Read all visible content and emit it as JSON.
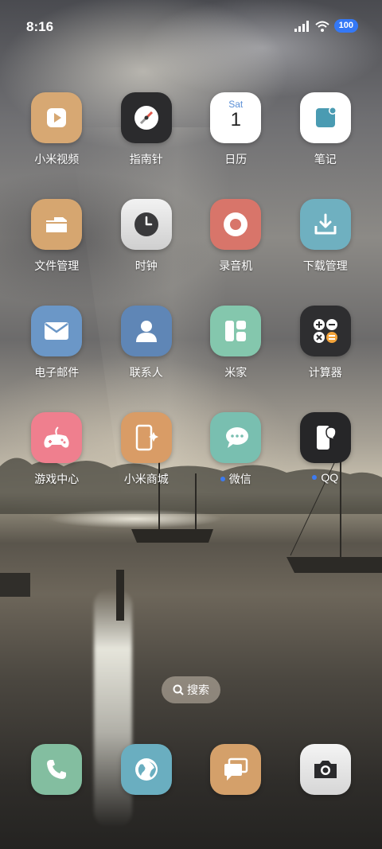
{
  "status_bar": {
    "time": "8:16",
    "battery": "100",
    "icons": [
      "signal-icon",
      "wifi-icon",
      "battery-icon"
    ]
  },
  "apps": [
    {
      "label": "小米视频",
      "icon": "video-play-icon",
      "color": "#d7a873"
    },
    {
      "label": "指南针",
      "icon": "compass-icon",
      "color": "#2b2b2d"
    },
    {
      "label": "日历",
      "icon": "calendar-icon",
      "color": "#ffffff",
      "calendar_day": "Sat",
      "calendar_date": "1"
    },
    {
      "label": "笔记",
      "icon": "notes-icon",
      "color": "#ffffff"
    },
    {
      "label": "文件管理",
      "icon": "folder-icon",
      "color": "#d6a670"
    },
    {
      "label": "时钟",
      "icon": "clock-icon",
      "color": "#e6e6e6"
    },
    {
      "label": "录音机",
      "icon": "record-icon",
      "color": "#d8756a"
    },
    {
      "label": "下载管理",
      "icon": "download-icon",
      "color": "#6fb0c0"
    },
    {
      "label": "电子邮件",
      "icon": "mail-icon",
      "color": "#6b97c7"
    },
    {
      "label": "联系人",
      "icon": "contact-icon",
      "color": "#5f86b6"
    },
    {
      "label": "米家",
      "icon": "grid-blocks-icon",
      "color": "#84c7ad"
    },
    {
      "label": "计算器",
      "icon": "calculator-icon",
      "color": "#2e2e30"
    },
    {
      "label": "游戏中心",
      "icon": "gamepad-icon",
      "color": "#ef7f8e"
    },
    {
      "label": "小米商城",
      "icon": "shop-icon",
      "color": "#d99c66"
    },
    {
      "label": "微信",
      "icon": "chat-bubbles-icon",
      "color": "#79bfb0",
      "new_dot": true
    },
    {
      "label": "QQ",
      "icon": "qq-phone-icon",
      "color": "#262628",
      "new_dot": true
    }
  ],
  "search": {
    "label": "搜索",
    "icon": "search-icon"
  },
  "dock": [
    {
      "name": "phone",
      "icon": "phone-icon",
      "color": "#83bea0"
    },
    {
      "name": "browser",
      "icon": "globe-icon",
      "color": "#6aaec0"
    },
    {
      "name": "messages",
      "icon": "message-icon",
      "color": "#d4a06a"
    },
    {
      "name": "camera",
      "icon": "camera-icon",
      "color": "#e9e9e9"
    }
  ]
}
